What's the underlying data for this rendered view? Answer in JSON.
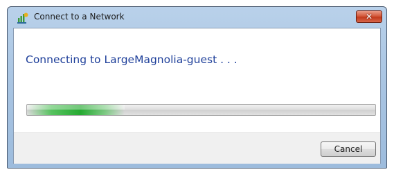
{
  "window": {
    "title": "Connect to a Network",
    "icon": "network-icon",
    "close_icon": "close-icon",
    "close_glyph": "✕"
  },
  "main": {
    "status_text": "Connecting to LargeMagnolia-guest . . .",
    "progress": {
      "style": "marquee",
      "glow_start_fraction": 0.0,
      "glow_end_fraction": 0.28
    }
  },
  "footer": {
    "cancel_label": "Cancel"
  },
  "colors": {
    "status_text": "#1e3f9a",
    "progress_glow": "#26aa32",
    "close_button": "#c23a1c",
    "titlebar": "#a8c4e2"
  }
}
